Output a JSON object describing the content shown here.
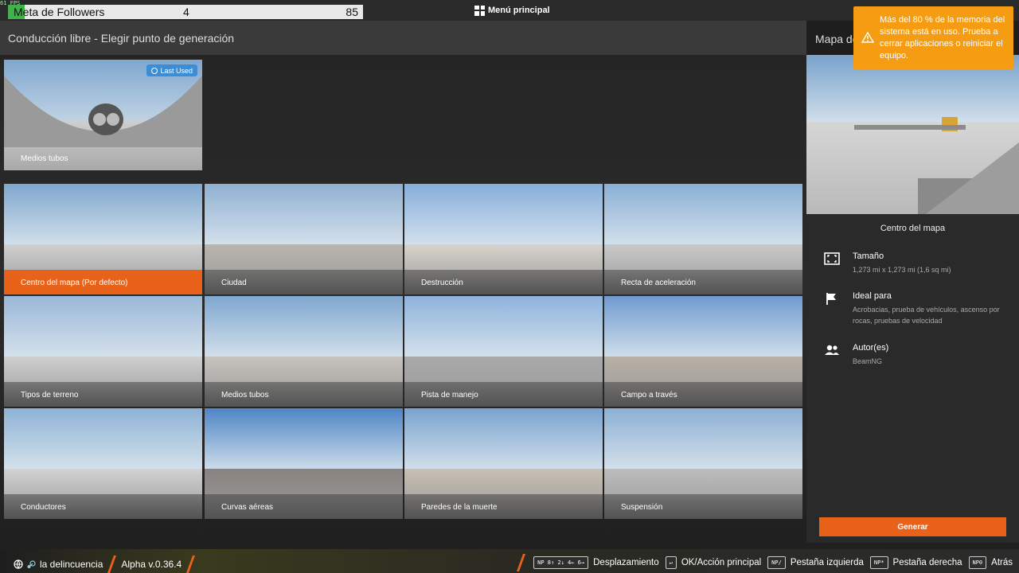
{
  "overlay": {
    "fps": "61 FPS",
    "followers_label": "Meta de Followers",
    "followers_current": "4",
    "followers_goal": "85",
    "followers_progress": 0.047,
    "main_menu": "Menú principal"
  },
  "header": {
    "title": "Conducción libre - Elegir punto de generación",
    "side_title": "Mapa de"
  },
  "toast": {
    "message": "Más del 80 % de la memoria del sistema está en uso. Prueba a cerrar aplicaciones o reiniciar el equipo."
  },
  "last_used": {
    "badge": "Last Used",
    "label": "Medios tubos"
  },
  "spawns": [
    {
      "label": "Centro del mapa (Por defecto)",
      "selected": true
    },
    {
      "label": "Ciudad"
    },
    {
      "label": "Destrucción"
    },
    {
      "label": "Recta de aceleración"
    },
    {
      "label": "Tipos de terreno"
    },
    {
      "label": "Medios tubos"
    },
    {
      "label": "Pista de manejo"
    },
    {
      "label": "Campo a través"
    },
    {
      "label": "Conductores"
    },
    {
      "label": "Curvas aéreas"
    },
    {
      "label": "Paredes de la muerte"
    },
    {
      "label": "Suspensión"
    }
  ],
  "side": {
    "map_name": "Centro del mapa",
    "size_label": "Tamaño",
    "size_value": "1,273 mi x 1,273 mi (1,6 sq mi)",
    "ideal_label": "Ideal para",
    "ideal_value": "Acrobacias, prueba de vehículos, ascenso por rocas, pruebas de velocidad",
    "author_label": "Autor(es)",
    "author_value": "BeamNG",
    "generate_button": "Generar"
  },
  "bottom": {
    "user": "la delincuencia",
    "version": "Alpha v.0.36.4",
    "hints": [
      {
        "key": "NP 8↑ 2↓ 4← 6→",
        "label": "Desplazamiento"
      },
      {
        "key": "↵",
        "label": "OK/Acción principal"
      },
      {
        "key": "NP/",
        "label": "Pestaña izquierda"
      },
      {
        "key": "NP*",
        "label": "Pestaña derecha"
      },
      {
        "key": "NP0",
        "label": "Atrás"
      }
    ]
  }
}
